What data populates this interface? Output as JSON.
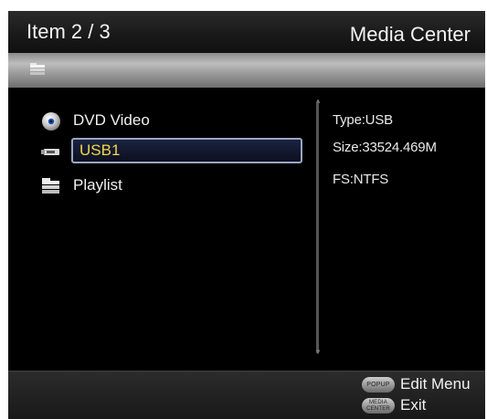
{
  "header": {
    "item_count": "Item 2 / 3",
    "title": "Media Center"
  },
  "pathbar": {
    "icon": "folder-icon"
  },
  "list": {
    "items": [
      {
        "label": "DVD Video",
        "icon": "disc-icon",
        "selected": false
      },
      {
        "label": "USB1",
        "icon": "usb-drive-icon",
        "selected": true
      },
      {
        "label": "Playlist",
        "icon": "folder-icon",
        "selected": false
      }
    ]
  },
  "info": {
    "type": "Type:USB",
    "size": "Size:33524.469M",
    "fs": "FS:NTFS"
  },
  "footer": {
    "hints": [
      {
        "key": "POPUP",
        "label": "Edit Menu"
      },
      {
        "key_line1": "MEDIA",
        "key_line2": "CENTER",
        "label": "Exit"
      }
    ]
  },
  "colors": {
    "selected_text": "#f0d64a",
    "text": "#f0f0f0",
    "background": "#000000",
    "highlight_border": "#9aa6c4"
  }
}
